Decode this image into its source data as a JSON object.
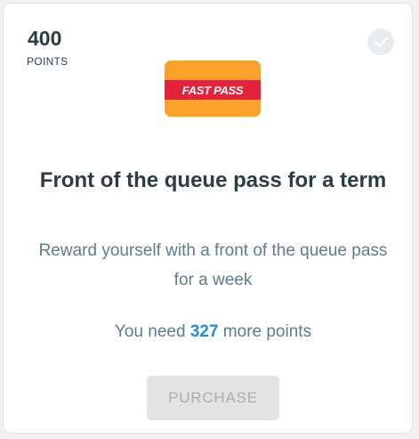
{
  "points": {
    "value": "400",
    "label": "POINTS"
  },
  "status_icon": "checkmark-circle-icon",
  "badge": {
    "text": "FAST PASS",
    "colors": {
      "background": "#f9a12a",
      "band": "#e2233b",
      "text": "#ffffff"
    }
  },
  "reward": {
    "title": "Front of the queue pass for a term",
    "description": "Reward yourself with a front of the queue pass for a week"
  },
  "requirement": {
    "prefix": "You need",
    "amount": "327",
    "suffix": "more points"
  },
  "purchase_button": {
    "label": "PURCHASE",
    "state": "disabled"
  },
  "colors": {
    "text_dark": "#2b3d45",
    "text_muted": "#5d7d8a",
    "accent": "#1f8ed8",
    "button_disabled_bg": "#e3e3e3",
    "button_disabled_text": "#ababab"
  }
}
